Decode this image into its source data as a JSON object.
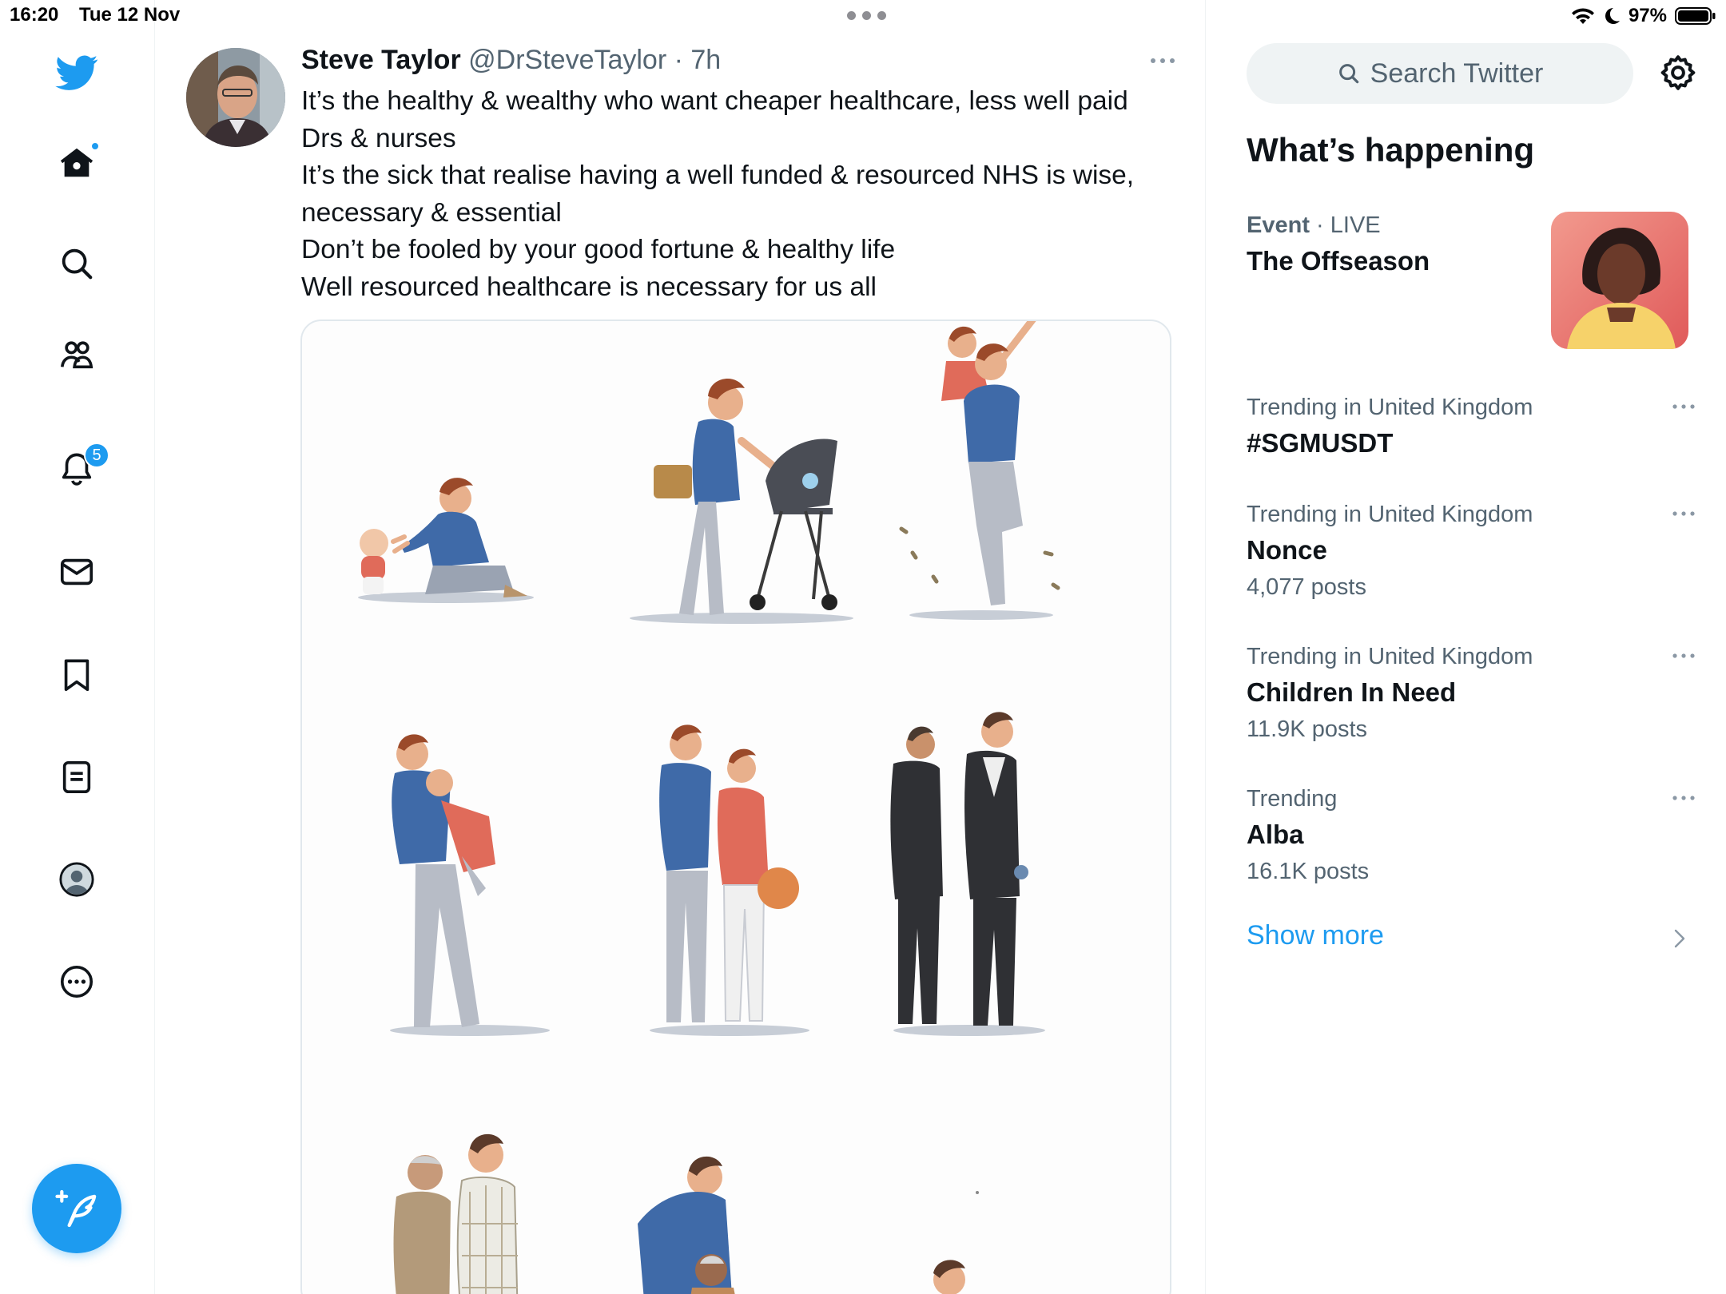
{
  "status_bar": {
    "time": "16:20",
    "date": "Tue 12 Nov",
    "battery": "97%"
  },
  "nav": {
    "items": [
      {
        "name": "home",
        "icon": "home-icon"
      },
      {
        "name": "explore",
        "icon": "search-icon"
      },
      {
        "name": "communities",
        "icon": "communities-icon"
      },
      {
        "name": "notifications",
        "icon": "bell-icon",
        "badge": "5"
      },
      {
        "name": "messages",
        "icon": "envelope-icon"
      },
      {
        "name": "bookmarks",
        "icon": "bookmark-icon"
      },
      {
        "name": "lists",
        "icon": "list-icon"
      },
      {
        "name": "profile",
        "icon": "avatar-icon"
      },
      {
        "name": "more",
        "icon": "more-circle-icon"
      }
    ],
    "notification_badge": "5",
    "compose_icon": "compose-feather-icon"
  },
  "tweet": {
    "name": "Steve Taylor",
    "handle": "@DrSteveTaylor",
    "separator": " · ",
    "time": "7h",
    "lines": [
      "It’s the healthy & wealthy who want cheaper healthcare, less well paid",
      "Drs & nurses",
      "It’s the sick that realise having a well funded & resourced NHS is wise,",
      "necessary & essential",
      "Don’t be fooled by your good fortune & healthy life",
      "Well resourced healthcare is necessary for us all"
    ]
  },
  "sidebar": {
    "search_placeholder": "Search Twitter",
    "section_title": "What’s happening",
    "event": {
      "category": "Event",
      "live": " · LIVE",
      "title": "The Offseason"
    },
    "trends": [
      {
        "meta": "Trending in United Kingdom",
        "title": "#SGMUSDT",
        "count": ""
      },
      {
        "meta": "Trending in United Kingdom",
        "title": "Nonce",
        "count": "4,077 posts"
      },
      {
        "meta": "Trending in United Kingdom",
        "title": "Children In Need",
        "count": "11.9K posts"
      },
      {
        "meta": "Trending",
        "title": "Alba",
        "count": "16.1K posts"
      }
    ],
    "show_more": "Show more"
  },
  "colors": {
    "accent": "#1d9bf0",
    "text": "#0f1419",
    "secondary": "#536471",
    "border": "#eff3f4"
  }
}
